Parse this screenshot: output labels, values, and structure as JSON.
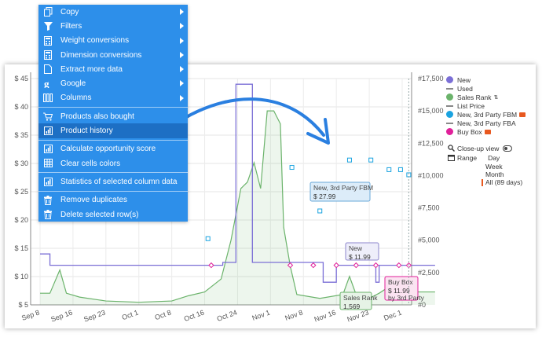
{
  "chart_data": {
    "type": "line",
    "x_labels": [
      "Sep 8",
      "Sep 16",
      "Sep 23",
      "Oct 1",
      "Oct 8",
      "Oct 16",
      "Oct 24",
      "Nov 1",
      "Nov 8",
      "Nov 16",
      "Nov 23",
      "Dec 1"
    ],
    "y_left_ticks": [
      "$ 45",
      "$ 40",
      "$ 35",
      "$ 30",
      "$ 25",
      "$ 20",
      "$ 15",
      "$ 10",
      "$ 5"
    ],
    "y_right_ticks": [
      "#17,500",
      "#15,000",
      "#12,500",
      "#10,000",
      "#7,500",
      "#5,000",
      "#2,500",
      "#0"
    ],
    "ylim_left": [
      5,
      45
    ],
    "ylim_right": [
      0,
      17500
    ],
    "series": [
      {
        "name": "New",
        "color": "#7b6fd6",
        "points": [
          [
            0,
            14
          ],
          [
            0.3,
            14
          ],
          [
            0.3,
            12
          ],
          [
            5.55,
            12
          ],
          [
            5.55,
            12.5
          ],
          [
            5.95,
            12.5
          ],
          [
            5.95,
            44
          ],
          [
            6.45,
            44
          ],
          [
            6.45,
            12.5
          ],
          [
            8.6,
            12.5
          ],
          [
            8.6,
            9
          ],
          [
            9,
            9
          ],
          [
            9,
            12
          ],
          [
            10.2,
            12
          ],
          [
            10.2,
            9
          ],
          [
            10.3,
            9
          ],
          [
            10.3,
            12
          ],
          [
            12,
            12
          ]
        ]
      },
      {
        "name": "Sales Rank",
        "color": "#6bb36b",
        "points": [
          [
            0,
            900
          ],
          [
            0.3,
            900
          ],
          [
            0.6,
            2700
          ],
          [
            0.8,
            900
          ],
          [
            1.2,
            600
          ],
          [
            2,
            300
          ],
          [
            3,
            200
          ],
          [
            4,
            300
          ],
          [
            4.5,
            700
          ],
          [
            5,
            1000
          ],
          [
            5.5,
            2000
          ],
          [
            5.8,
            5000
          ],
          [
            5.95,
            7000
          ],
          [
            6.1,
            9000
          ],
          [
            6.3,
            9500
          ],
          [
            6.5,
            11000
          ],
          [
            6.7,
            9000
          ],
          [
            6.9,
            15000
          ],
          [
            7.1,
            15000
          ],
          [
            7.3,
            14000
          ],
          [
            7.4,
            6000
          ],
          [
            7.6,
            3000
          ],
          [
            7.8,
            800
          ],
          [
            8.5,
            500
          ],
          [
            9.2,
            800
          ],
          [
            9.4,
            2200
          ],
          [
            9.6,
            800
          ],
          [
            10,
            500
          ],
          [
            10.3,
            900
          ],
          [
            10.6,
            1400
          ],
          [
            10.9,
            1569
          ],
          [
            11.2,
            1200
          ],
          [
            11.5,
            1000
          ],
          [
            12,
            1000
          ]
        ]
      },
      {
        "name": "New, 3rd Party FBM",
        "color": "#1aa3e0",
        "points": [
          [
            5.1,
            16.7
          ],
          [
            7.65,
            29.3
          ],
          [
            8.5,
            21.6
          ],
          [
            9.4,
            30.6
          ],
          [
            10.05,
            30.6
          ],
          [
            10.6,
            28.9
          ],
          [
            10.95,
            28.9
          ],
          [
            11.2,
            27.99
          ]
        ]
      },
      {
        "name": "Buy Box",
        "color": "#e0209a",
        "points": [
          [
            5.2,
            12
          ],
          [
            7.6,
            12
          ],
          [
            8.3,
            12
          ],
          [
            9,
            12
          ],
          [
            9.6,
            12
          ],
          [
            10.2,
            12
          ],
          [
            10.9,
            12
          ],
          [
            11.2,
            11.99
          ]
        ]
      }
    ],
    "tooltips": [
      {
        "label": "New, 3rd Party FBM",
        "value": "$ 27.99"
      },
      {
        "label": "New",
        "value": "$ 11.99"
      },
      {
        "label": "Buy Box",
        "value": "$ 11.99",
        "extra": "by 3rd Party"
      },
      {
        "label": "Sales Rank",
        "value": "1,569"
      }
    ]
  },
  "legend": {
    "items": [
      {
        "label": "New",
        "kind": "dot",
        "color": "#7b6fd6"
      },
      {
        "label": "Used",
        "kind": "line",
        "color": "#888888"
      },
      {
        "label": "Sales Rank",
        "kind": "dot",
        "color": "#6bb36b",
        "icon": "sort-icon"
      },
      {
        "label": "List Price",
        "kind": "line",
        "color": "#888888"
      },
      {
        "label": "New, 3rd Party FBM",
        "kind": "dot",
        "color": "#1aa3e0",
        "icon": "truck-icon"
      },
      {
        "label": "New, 3rd Party FBA",
        "kind": "line",
        "color": "#888888"
      },
      {
        "label": "Buy Box",
        "kind": "dot",
        "color": "#e0209a",
        "icon": "truck-icon"
      }
    ],
    "closeup_label": "Close-up view",
    "range_label": "Range",
    "range_options": [
      "Day",
      "Week",
      "Month"
    ],
    "range_all": "All (89 days)"
  },
  "menu": {
    "items": [
      {
        "label": "Copy",
        "icon": "copy-icon",
        "submenu": true
      },
      {
        "label": "Filters",
        "icon": "filter-icon",
        "submenu": true
      },
      {
        "label": "Weight conversions",
        "icon": "calculator-icon",
        "submenu": true
      },
      {
        "label": "Dimension conversions",
        "icon": "calculator-icon",
        "submenu": true
      },
      {
        "label": "Extract more data",
        "icon": "document-icon",
        "submenu": true
      },
      {
        "label": "Google",
        "icon": "google-icon",
        "submenu": true
      },
      {
        "label": "Columns",
        "icon": "columns-icon",
        "submenu": true
      },
      {
        "sep": true
      },
      {
        "label": "Products also bought",
        "icon": "cart-icon"
      },
      {
        "label": "Product history",
        "icon": "chart-icon",
        "active": true
      },
      {
        "sep": true
      },
      {
        "label": "Calculate opportunity score",
        "icon": "chart-icon"
      },
      {
        "label": "Clear cells colors",
        "icon": "grid-icon"
      },
      {
        "sep": true
      },
      {
        "label": "Statistics of selected column data",
        "icon": "chart-icon"
      },
      {
        "sep": true
      },
      {
        "label": "Remove duplicates",
        "icon": "trash-icon"
      },
      {
        "label": "Delete selected row(s)",
        "icon": "trash-icon"
      }
    ]
  },
  "colors": {
    "menu": "#2d8fea",
    "arrow": "#2a7fe0"
  }
}
